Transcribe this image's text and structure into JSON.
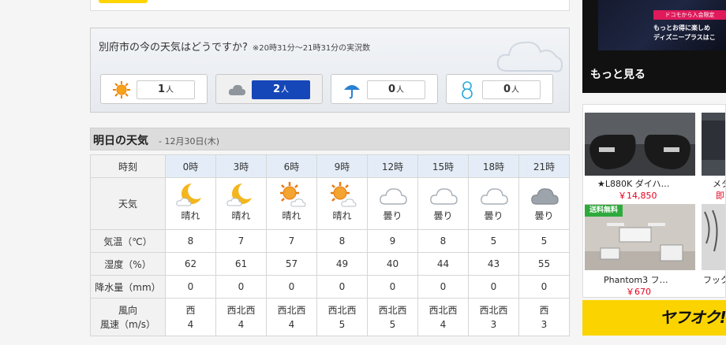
{
  "poll": {
    "question": "別府市の今の天気はどうですか?",
    "period": "※20時31分～21時31分の実況数",
    "unit": "人",
    "options": [
      {
        "icon": "sun-icon",
        "count": "1"
      },
      {
        "icon": "cloud-icon",
        "count": "2",
        "selected": true
      },
      {
        "icon": "umbrella-icon",
        "count": "0"
      },
      {
        "icon": "snowman-icon",
        "count": "0"
      }
    ]
  },
  "tomorrow": {
    "title": "明日の天気",
    "date": " - 12月30日(木)"
  },
  "forecast": {
    "labels": {
      "time": "時刻",
      "weather": "天気",
      "temp": "気温（℃）",
      "humidity": "湿度（%）",
      "precip": "降水量（mm）",
      "wind_dir": "風向",
      "wind_speed": "風速（m/s）"
    },
    "hours": [
      "0時",
      "3時",
      "6時",
      "9時",
      "12時",
      "15時",
      "18時",
      "21時"
    ],
    "weather": [
      "晴れ",
      "晴れ",
      "晴れ",
      "晴れ",
      "曇り",
      "曇り",
      "曇り",
      "曇り"
    ],
    "weather_icons": [
      "moon-cloud-icon",
      "moon-cloud-icon",
      "sun-cloud-icon",
      "sun-cloud-icon",
      "cloud-icon",
      "cloud-icon",
      "cloud-icon",
      "dark-cloud-icon"
    ],
    "temp": [
      "8",
      "7",
      "7",
      "8",
      "9",
      "8",
      "5",
      "5"
    ],
    "humidity": [
      "62",
      "61",
      "57",
      "49",
      "40",
      "44",
      "43",
      "55"
    ],
    "precip": [
      "0",
      "0",
      "0",
      "0",
      "0",
      "0",
      "0",
      "0"
    ],
    "wind_dir": [
      "西",
      "西北西",
      "西北西",
      "西北西",
      "西北西",
      "西北西",
      "西北西",
      "西"
    ],
    "wind_speed": [
      "4",
      "4",
      "4",
      "5",
      "5",
      "4",
      "3",
      "3"
    ]
  },
  "ads": {
    "docomo_tag": "ドコモから入会限定",
    "docomo_line1": "もっとお得に楽しめ",
    "docomo_line2": "ディズニープラスはこ",
    "more": "もっと見る",
    "items": [
      {
        "name": "★L880K ダイハ…",
        "price": "￥14,850"
      },
      {
        "name": "メタ",
        "price": "即"
      },
      {
        "name": "Phantom3 フ…",
        "price": "￥670",
        "badge": "送料無料"
      },
      {
        "name": "フック",
        "price": ""
      }
    ],
    "auction_logo": "ヤフオク!"
  },
  "colors": {
    "selected_vote": "#1647b8",
    "header_row": "#e4edf7",
    "price": "#e6001e",
    "badge": "#2eaa3c",
    "auction_bg": "#fbd400"
  }
}
